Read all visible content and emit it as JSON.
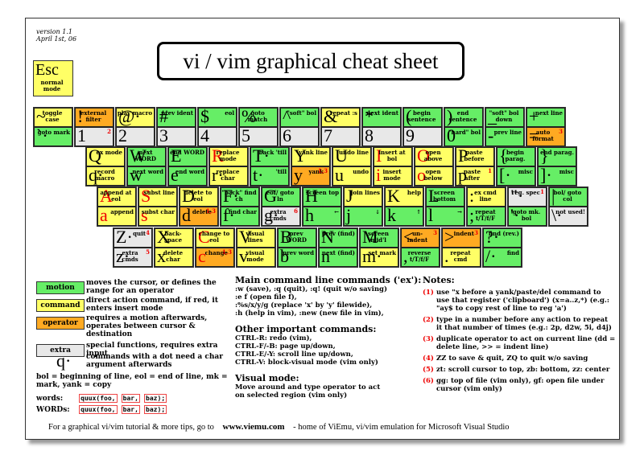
{
  "version": "version 1.1",
  "date": "April 1st, 06",
  "title": "vi / vim graphical cheat sheet",
  "esc": {
    "char": "Esc",
    "label": "normal mode"
  },
  "row1": [
    {
      "top": {
        "ch": "~",
        "label": "toggle case",
        "c": "y"
      },
      "bot": {
        "ch": "`·",
        "label": "goto mark",
        "c": "g"
      }
    },
    {
      "top": {
        "ch": "!",
        "label": "external filter",
        "c": "o"
      },
      "bot": {
        "ch": "1",
        "label": "",
        "c": "e",
        "sup": "2"
      }
    },
    {
      "top": {
        "ch": "@·",
        "label": "play macro",
        "c": "y"
      },
      "bot": {
        "ch": "2",
        "label": "",
        "c": "e"
      }
    },
    {
      "top": {
        "ch": "#",
        "label": "prev ident",
        "c": "g"
      },
      "bot": {
        "ch": "3",
        "label": "",
        "c": "e"
      }
    },
    {
      "top": {
        "ch": "$",
        "label": "eol",
        "c": "g"
      },
      "bot": {
        "ch": "4",
        "label": "",
        "c": "e"
      }
    },
    {
      "top": {
        "ch": "%",
        "label": "goto match",
        "c": "g"
      },
      "bot": {
        "ch": "5",
        "label": "",
        "c": "e"
      }
    },
    {
      "top": {
        "ch": "^",
        "label": "\"soft\" bol",
        "c": "g"
      },
      "bot": {
        "ch": "6",
        "label": "",
        "c": "e"
      }
    },
    {
      "top": {
        "ch": "&",
        "label": "repeat :s",
        "c": "y"
      },
      "bot": {
        "ch": "7",
        "label": "",
        "c": "e"
      }
    },
    {
      "top": {
        "ch": "*",
        "label": "next ident",
        "c": "g"
      },
      "bot": {
        "ch": "8",
        "label": "",
        "c": "e"
      }
    },
    {
      "top": {
        "ch": "(",
        "label": "begin sentence",
        "c": "g"
      },
      "bot": {
        "ch": "9",
        "label": "",
        "c": "e"
      }
    },
    {
      "top": {
        "ch": ")",
        "label": "end sentence",
        "c": "g"
      },
      "bot": {
        "ch": "0",
        "label": "\"hard\" bol",
        "c": "g"
      }
    },
    {
      "top": {
        "ch": "_",
        "label": "\"soft\" bol down",
        "c": "g"
      },
      "bot": {
        "ch": "-",
        "label": "prev line",
        "c": "g"
      }
    },
    {
      "top": {
        "ch": "+",
        "label": "next line",
        "c": "g"
      },
      "bot": {
        "ch": "=",
        "label": "auto format",
        "c": "o",
        "sup": "3"
      }
    }
  ],
  "row2": [
    {
      "top": {
        "ch": "Q",
        "label": "ex mode",
        "c": "y"
      },
      "bot": {
        "ch": "q·",
        "label": "record macro",
        "c": "y"
      }
    },
    {
      "top": {
        "ch": "W",
        "label": "next WORD",
        "c": "g"
      },
      "bot": {
        "ch": "w",
        "label": "next word",
        "c": "g"
      }
    },
    {
      "top": {
        "ch": "E",
        "label": "end WORD",
        "c": "g"
      },
      "bot": {
        "ch": "e",
        "label": "end word",
        "c": "g"
      }
    },
    {
      "top": {
        "ch": "R",
        "label": "replace mode",
        "c": "y",
        "red": true
      },
      "bot": {
        "ch": "r·",
        "label": "replace char",
        "c": "y"
      }
    },
    {
      "top": {
        "ch": "T·",
        "label": "back 'till",
        "c": "g"
      },
      "bot": {
        "ch": "t·",
        "label": "'till",
        "c": "g"
      }
    },
    {
      "top": {
        "ch": "Y",
        "label": "yank line",
        "c": "y"
      },
      "bot": {
        "ch": "y",
        "label": "yank",
        "c": "o",
        "sup": "1,3"
      }
    },
    {
      "top": {
        "ch": "U",
        "label": "undo line",
        "c": "y"
      },
      "bot": {
        "ch": "u",
        "label": "undo",
        "c": "y"
      }
    },
    {
      "top": {
        "ch": "I",
        "label": "insert at bol",
        "c": "y",
        "red": true
      },
      "bot": {
        "ch": "i",
        "label": "insert mode",
        "c": "y",
        "red": true
      }
    },
    {
      "top": {
        "ch": "O",
        "label": "open above",
        "c": "y",
        "red": true
      },
      "bot": {
        "ch": "o",
        "label": "open below",
        "c": "y",
        "red": true
      }
    },
    {
      "top": {
        "ch": "P",
        "label": "paste before",
        "c": "y"
      },
      "bot": {
        "ch": "p",
        "label": "paste after",
        "c": "y",
        "sup": "1"
      }
    },
    {
      "top": {
        "ch": "{",
        "label": "begin parag.",
        "c": "g"
      },
      "bot": {
        "ch": "[·",
        "label": "misc",
        "c": "g"
      }
    },
    {
      "top": {
        "ch": "}",
        "label": "end parag.",
        "c": "g"
      },
      "bot": {
        "ch": "]·",
        "label": "misc",
        "c": "g"
      }
    }
  ],
  "row3": [
    {
      "top": {
        "ch": "A",
        "label": "append at eol",
        "c": "y",
        "red": true
      },
      "bot": {
        "ch": "a",
        "label": "append",
        "c": "y",
        "red": true
      }
    },
    {
      "top": {
        "ch": "S",
        "label": "subst line",
        "c": "y",
        "red": true
      },
      "bot": {
        "ch": "s",
        "label": "subst char",
        "c": "y",
        "red": true
      }
    },
    {
      "top": {
        "ch": "D",
        "label": "delete to eol",
        "c": "y"
      },
      "bot": {
        "ch": "d",
        "label": "delete",
        "c": "o",
        "sup": "1,3"
      }
    },
    {
      "top": {
        "ch": "F·",
        "label": "\"back\" find ch",
        "c": "g"
      },
      "bot": {
        "ch": "f·",
        "label": "find char",
        "c": "g"
      }
    },
    {
      "top": {
        "ch": "G",
        "label": "eof/ goto ln",
        "c": "g"
      },
      "bot": {
        "ch": "g·",
        "label": "extra cmds",
        "c": "e",
        "sup": "6"
      }
    },
    {
      "top": {
        "ch": "H",
        "label": "screen top",
        "c": "g"
      },
      "bot": {
        "ch": "h",
        "label": "←",
        "c": "g"
      }
    },
    {
      "top": {
        "ch": "J",
        "label": "join lines",
        "c": "y"
      },
      "bot": {
        "ch": "j",
        "label": "↓",
        "c": "g"
      }
    },
    {
      "top": {
        "ch": "K",
        "label": "help",
        "c": "y"
      },
      "bot": {
        "ch": "k",
        "label": "↑",
        "c": "g"
      }
    },
    {
      "top": {
        "ch": "L",
        "label": "screen bottom",
        "c": "g"
      },
      "bot": {
        "ch": "l",
        "label": "→",
        "c": "g"
      }
    },
    {
      "top": {
        "ch": ":",
        "label": "ex cmd line",
        "c": "y"
      },
      "bot": {
        "ch": ";",
        "label": "repeat t/T/f/F",
        "c": "g"
      }
    },
    {
      "top": {
        "ch": "\"·",
        "label": "reg. spec",
        "c": "e",
        "sup": "1"
      },
      "bot": {
        "ch": "'·",
        "label": "goto mk. bol",
        "c": "g"
      }
    },
    {
      "top": {
        "ch": "|",
        "label": "bol/ goto col",
        "c": "g"
      },
      "bot": {
        "ch": "\\·",
        "label": "not used!",
        "c": "e"
      }
    }
  ],
  "row4": [
    {
      "top": {
        "ch": "Z·",
        "label": "quit",
        "c": "e",
        "sup": "4"
      },
      "bot": {
        "ch": "z·",
        "label": "extra cmds",
        "c": "e",
        "sup": "5"
      }
    },
    {
      "top": {
        "ch": "X",
        "label": "back- space",
        "c": "y"
      },
      "bot": {
        "ch": "x",
        "label": "delete char",
        "c": "y"
      }
    },
    {
      "top": {
        "ch": "C",
        "label": "change to eol",
        "c": "y",
        "red": true
      },
      "bot": {
        "ch": "c",
        "label": "change",
        "c": "o",
        "red": true,
        "sup": "1,3"
      }
    },
    {
      "top": {
        "ch": "V",
        "label": "visual lines",
        "c": "y"
      },
      "bot": {
        "ch": "v",
        "label": "visual mode",
        "c": "y"
      }
    },
    {
      "top": {
        "ch": "B",
        "label": "prev WORD",
        "c": "g"
      },
      "bot": {
        "ch": "b",
        "label": "prev word",
        "c": "g"
      }
    },
    {
      "top": {
        "ch": "N",
        "label": "prev (find)",
        "c": "g"
      },
      "bot": {
        "ch": "n",
        "label": "next (find)",
        "c": "g"
      }
    },
    {
      "top": {
        "ch": "M",
        "label": "screen mid'l",
        "c": "g"
      },
      "bot": {
        "ch": "m·",
        "label": "set mark",
        "c": "y"
      }
    },
    {
      "top": {
        "ch": "<",
        "label": "un- indent",
        "c": "o",
        "sup": "3"
      },
      "bot": {
        "ch": ",",
        "label": "reverse t/T/f/F",
        "c": "g"
      }
    },
    {
      "top": {
        "ch": ">",
        "label": "indent",
        "c": "o",
        "sup": "3"
      },
      "bot": {
        "ch": ".",
        "label": "repeat cmd",
        "c": "y"
      }
    },
    {
      "top": {
        "ch": "?·",
        "label": "find (rev.)",
        "c": "g"
      },
      "bot": {
        "ch": "/·",
        "label": "find",
        "c": "g"
      }
    }
  ],
  "legend": [
    {
      "box": "motion",
      "c": "#66ee66",
      "text": "moves the cursor, or defines the range for an operator"
    },
    {
      "box": "command",
      "c": "#ffff66",
      "text": "direct action command, if red, it enters insert mode"
    },
    {
      "box": "operator",
      "c": "#ffaa22",
      "text": "requires a motion afterwards, operates between cursor & destination"
    },
    {
      "box": "extra",
      "c": "#e8e8e8",
      "text": "special functions, requires extra input"
    }
  ],
  "dot_example": {
    "ch": "q·",
    "text": "commands with a dot need a char argument afterwards"
  },
  "abbrev": "bol = beginning of line, eol = end of line, mk = mark, yank = copy",
  "words": {
    "label": "words:",
    "parts": [
      "quux(foo,",
      "bar,",
      "baz);"
    ]
  },
  "WORDs": {
    "label": "WORDs:",
    "parts": [
      "quux(foo,",
      "bar,",
      "baz);"
    ]
  },
  "main_cmds": {
    "title": "Main command line commands ('ex'):",
    "lines": [
      ":w (save), :q (quit), :q! (quit w/o saving)",
      ":e f (open file f),",
      ":%s/x/y/g (replace 'x' by 'y' filewide),",
      ":h (help in vim), :new (new file in vim),"
    ]
  },
  "other_cmds": {
    "title": "Other important commands:",
    "lines": [
      "CTRL-R: redo (vim),",
      "CTRL-F/-B: page up/down,",
      "CTRL-E/-Y: scroll line up/down,",
      "CTRL-V: block-visual mode (vim only)"
    ]
  },
  "visual": {
    "title": "Visual mode:",
    "lines": [
      "Move around and type operator to act",
      "on selected region (vim only)"
    ]
  },
  "notes": {
    "title": "Notes:",
    "items": [
      {
        "n": "(1)",
        "text": "use \"x before a yank/paste/del command to use that register ('clipboard') (x=a..z,*) (e.g.: \"ay$ to copy rest of line to reg 'a')"
      },
      {
        "n": "(2)",
        "text": "type in a number before any action to repeat it that number of times (e.g.: 2p, d2w, 5i, d4j)"
      },
      {
        "n": "(3)",
        "text": "duplicate operator to act on current line (dd = delete line, >> = indent line)"
      },
      {
        "n": "(4)",
        "text": "ZZ to save & quit, ZQ to quit w/o saving"
      },
      {
        "n": "(5)",
        "text": "zt: scroll cursor to top, zb: bottom, zz: center"
      },
      {
        "n": "(6)",
        "text": "gg: top of file (vim only), gf: open file under cursor (vim only)"
      }
    ]
  },
  "footer": {
    "pre": "For a graphical vi/vim tutorial & more tips, go to",
    "url": "www.viemu.com",
    "post": "- home of ViEmu, vi/vim emulation for Microsoft Visual Studio"
  }
}
